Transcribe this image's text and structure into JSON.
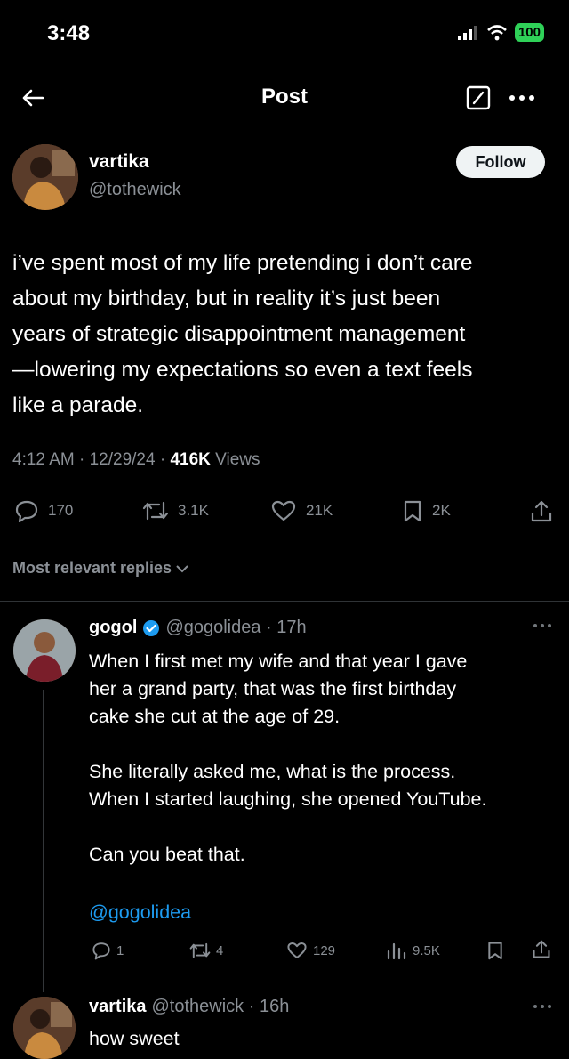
{
  "status_bar": {
    "time": "3:48",
    "battery": "100"
  },
  "nav": {
    "title": "Post"
  },
  "post": {
    "author_name": "vartika",
    "author_handle": "@tothewick",
    "follow_label": "Follow",
    "lines": [
      "i’ve spent most of my life pretending i don’t care",
      "about my birthday, but in reality it’s just been",
      "years of strategic disappointment management",
      "—lowering my expectations so even a text feels",
      "like a parade."
    ],
    "timestamp": "4:12 AM · 12/29/24 · ",
    "views_count": "416K",
    "views_label": " Views",
    "replies": "170",
    "reposts": "3.1K",
    "likes": "21K",
    "bookmarks": "2K"
  },
  "sort": {
    "label": "Most relevant replies"
  },
  "reply1": {
    "name": "gogol",
    "handle_time": "@gogolidea · 17h",
    "lines": [
      "When I first met my wife and that year I gave",
      "her a grand party, that was the first birthday",
      "cake she cut at the age of 29.",
      "",
      "She literally asked me, what is the process.",
      "When I started laughing, she opened YouTube.",
      "",
      "Can you beat that."
    ],
    "mention": "@gogolidea",
    "replies": "1",
    "reposts": "4",
    "likes": "129",
    "views": "9.5K"
  },
  "reply2": {
    "name": "vartika",
    "handle_time": "@tothewick · 16h",
    "text": "how sweet"
  },
  "colors": {
    "background": "#000000",
    "accent": "#1d9bf0",
    "verified": "#1d9bf0",
    "muted": "#8b9096"
  }
}
